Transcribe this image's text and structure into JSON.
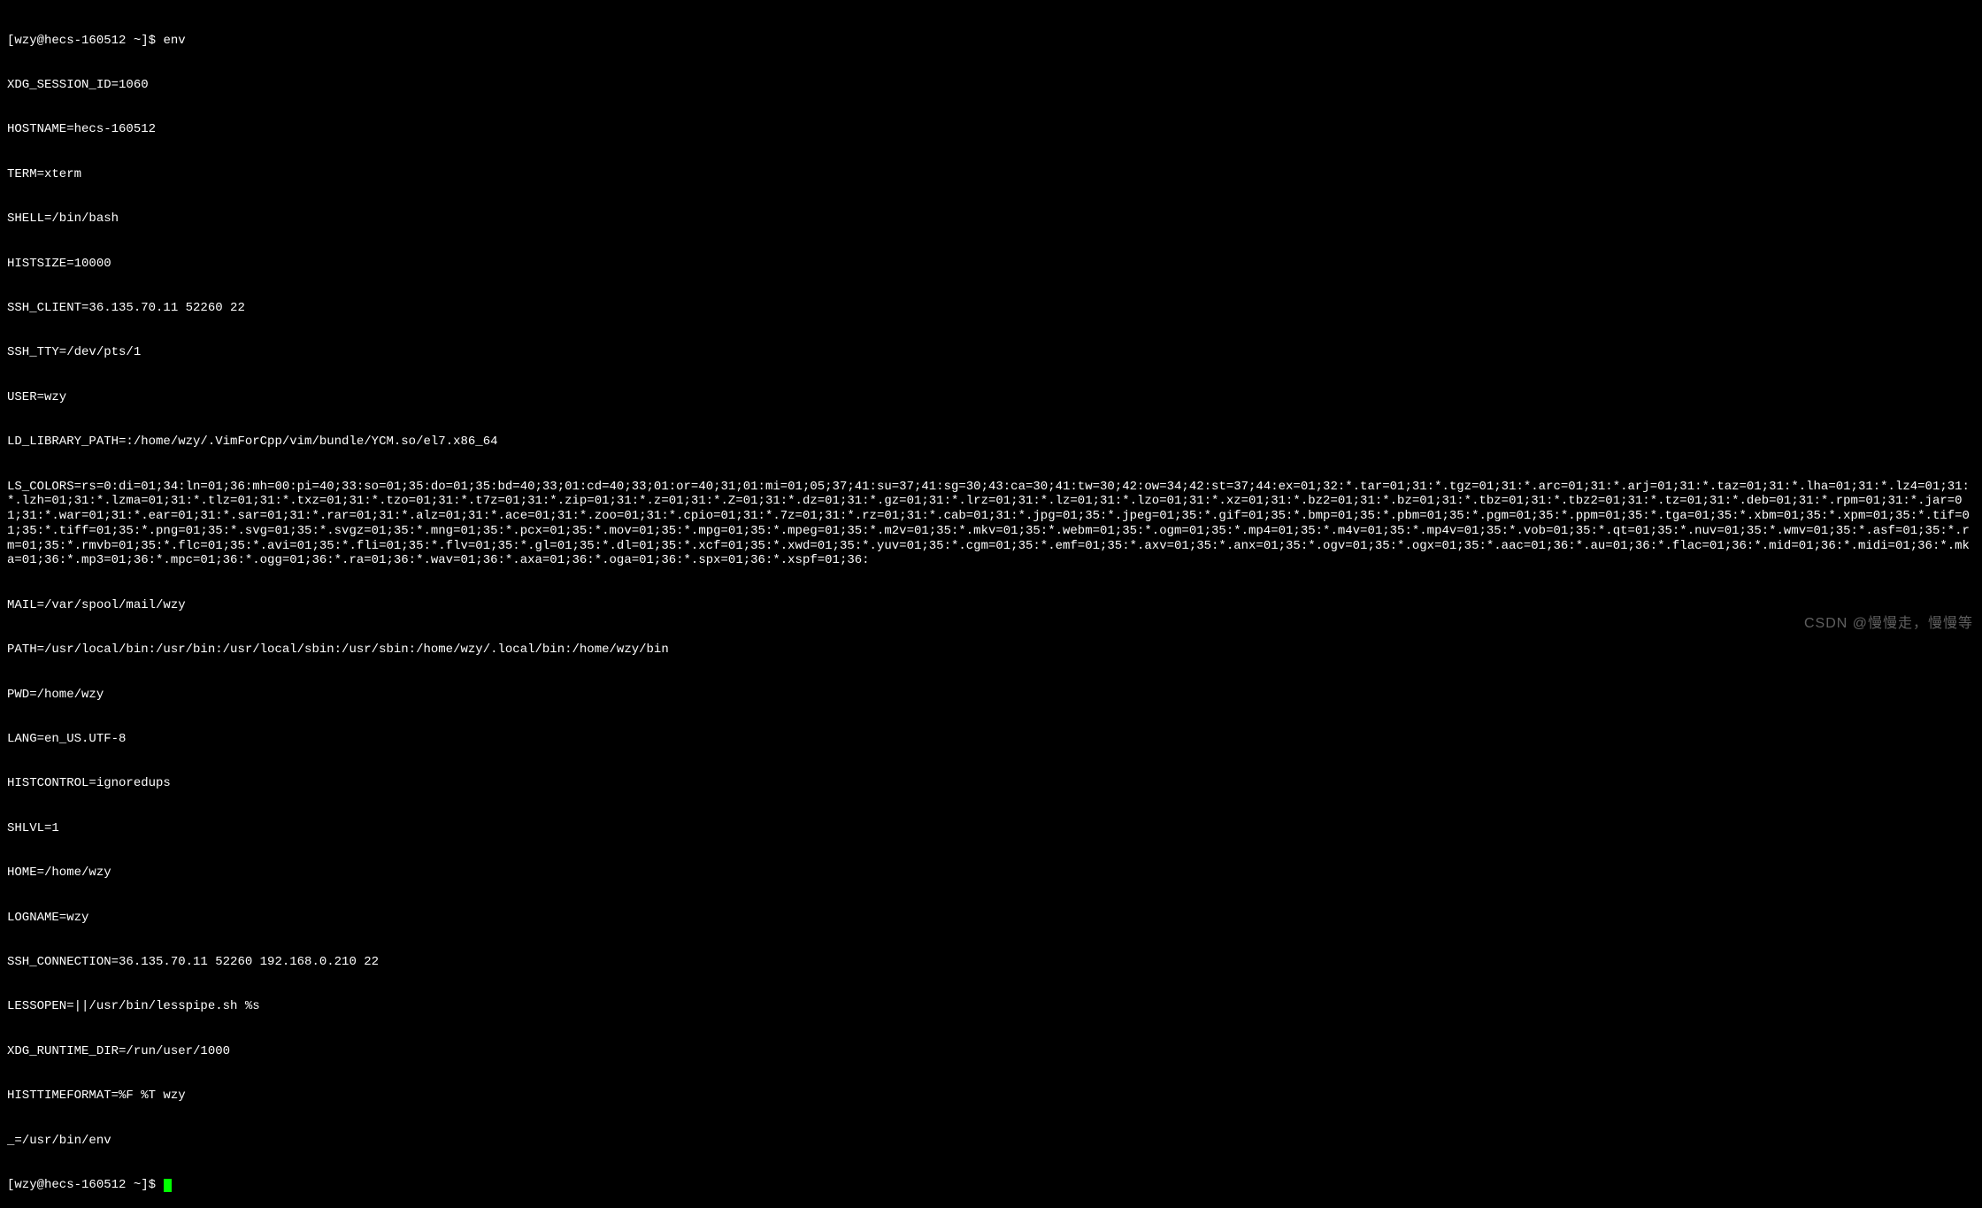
{
  "terminal": {
    "prompt1": "[wzy@hecs-160512 ~]$ ",
    "command": "env",
    "output_lines": [
      "XDG_SESSION_ID=1060",
      "HOSTNAME=hecs-160512",
      "TERM=xterm",
      "SHELL=/bin/bash",
      "HISTSIZE=10000",
      "SSH_CLIENT=36.135.70.11 52260 22",
      "SSH_TTY=/dev/pts/1",
      "USER=wzy",
      "LD_LIBRARY_PATH=:/home/wzy/.VimForCpp/vim/bundle/YCM.so/el7.x86_64",
      "LS_COLORS=rs=0:di=01;34:ln=01;36:mh=00:pi=40;33:so=01;35:do=01;35:bd=40;33;01:cd=40;33;01:or=40;31;01:mi=01;05;37;41:su=37;41:sg=30;43:ca=30;41:tw=30;42:ow=34;42:st=37;44:ex=01;32:*.tar=01;31:*.tgz=01;31:*.arc=01;31:*.arj=01;31:*.taz=01;31:*.lha=01;31:*.lz4=01;31:*.lzh=01;31:*.lzma=01;31:*.tlz=01;31:*.txz=01;31:*.tzo=01;31:*.t7z=01;31:*.zip=01;31:*.z=01;31:*.Z=01;31:*.dz=01;31:*.gz=01;31:*.lrz=01;31:*.lz=01;31:*.lzo=01;31:*.xz=01;31:*.bz2=01;31:*.bz=01;31:*.tbz=01;31:*.tbz2=01;31:*.tz=01;31:*.deb=01;31:*.rpm=01;31:*.jar=01;31:*.war=01;31:*.ear=01;31:*.sar=01;31:*.rar=01;31:*.alz=01;31:*.ace=01;31:*.zoo=01;31:*.cpio=01;31:*.7z=01;31:*.rz=01;31:*.cab=01;31:*.jpg=01;35:*.jpeg=01;35:*.gif=01;35:*.bmp=01;35:*.pbm=01;35:*.pgm=01;35:*.ppm=01;35:*.tga=01;35:*.xbm=01;35:*.xpm=01;35:*.tif=01;35:*.tiff=01;35:*.png=01;35:*.svg=01;35:*.svgz=01;35:*.mng=01;35:*.pcx=01;35:*.mov=01;35:*.mpg=01;35:*.mpeg=01;35:*.m2v=01;35:*.mkv=01;35:*.webm=01;35:*.ogm=01;35:*.mp4=01;35:*.m4v=01;35:*.mp4v=01;35:*.vob=01;35:*.qt=01;35:*.nuv=01;35:*.wmv=01;35:*.asf=01;35:*.rm=01;35:*.rmvb=01;35:*.flc=01;35:*.avi=01;35:*.fli=01;35:*.flv=01;35:*.gl=01;35:*.dl=01;35:*.xcf=01;35:*.xwd=01;35:*.yuv=01;35:*.cgm=01;35:*.emf=01;35:*.axv=01;35:*.anx=01;35:*.ogv=01;35:*.ogx=01;35:*.aac=01;36:*.au=01;36:*.flac=01;36:*.mid=01;36:*.midi=01;36:*.mka=01;36:*.mp3=01;36:*.mpc=01;36:*.ogg=01;36:*.ra=01;36:*.wav=01;36:*.axa=01;36:*.oga=01;36:*.spx=01;36:*.xspf=01;36:",
      "MAIL=/var/spool/mail/wzy",
      "PATH=/usr/local/bin:/usr/bin:/usr/local/sbin:/usr/sbin:/home/wzy/.local/bin:/home/wzy/bin",
      "PWD=/home/wzy",
      "LANG=en_US.UTF-8",
      "HISTCONTROL=ignoredups",
      "SHLVL=1",
      "HOME=/home/wzy",
      "LOGNAME=wzy",
      "SSH_CONNECTION=36.135.70.11 52260 192.168.0.210 22",
      "LESSOPEN=||/usr/bin/lesspipe.sh %s",
      "XDG_RUNTIME_DIR=/run/user/1000",
      "HISTTIMEFORMAT=%F %T wzy ",
      "_=/usr/bin/env"
    ],
    "prompt2": "[wzy@hecs-160512 ~]$ "
  },
  "watermark": "CSDN @慢慢走，慢慢等"
}
